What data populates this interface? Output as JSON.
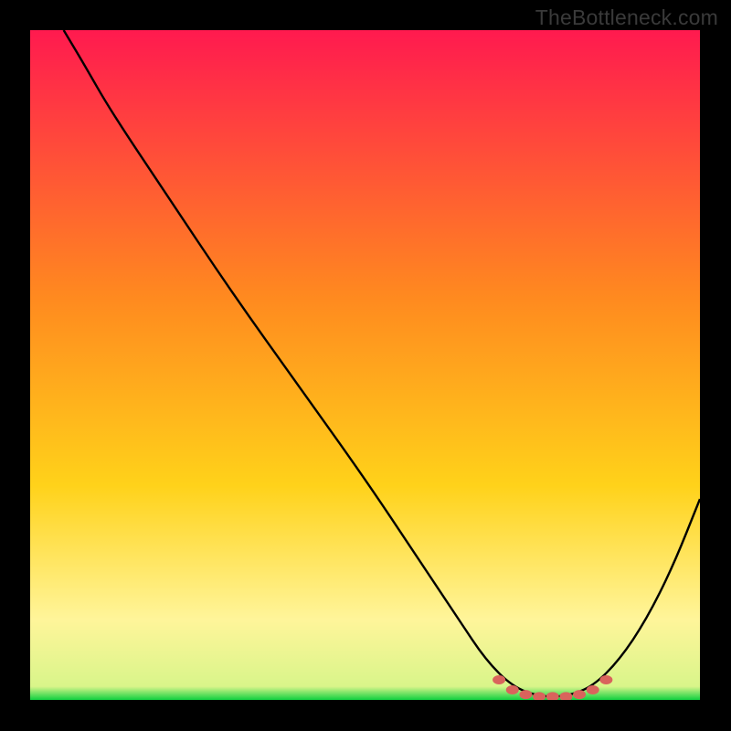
{
  "attribution": "TheBottleneck.com",
  "colors": {
    "bg": "#000000",
    "text": "#3a3a3a",
    "curve": "#000000",
    "markers": "#d9635c",
    "grad_top": "#ff1a4f",
    "grad_mid1": "#ff6a33",
    "grad_mid2": "#ffd21a",
    "grad_mid3": "#fff59a",
    "grad_bottom": "#10d040"
  },
  "chart_data": {
    "type": "line",
    "title": "",
    "xlabel": "",
    "ylabel": "",
    "xlim": [
      0,
      100
    ],
    "ylim": [
      0,
      100
    ],
    "curve": [
      {
        "x": 5,
        "y": 100
      },
      {
        "x": 8,
        "y": 95
      },
      {
        "x": 12,
        "y": 88
      },
      {
        "x": 20,
        "y": 76
      },
      {
        "x": 30,
        "y": 61
      },
      {
        "x": 40,
        "y": 47
      },
      {
        "x": 50,
        "y": 33
      },
      {
        "x": 58,
        "y": 21
      },
      {
        "x": 64,
        "y": 12
      },
      {
        "x": 68,
        "y": 6
      },
      {
        "x": 72,
        "y": 2
      },
      {
        "x": 76,
        "y": 0.5
      },
      {
        "x": 80,
        "y": 0.5
      },
      {
        "x": 84,
        "y": 2
      },
      {
        "x": 88,
        "y": 6
      },
      {
        "x": 92,
        "y": 12
      },
      {
        "x": 96,
        "y": 20
      },
      {
        "x": 100,
        "y": 30
      }
    ],
    "markers": [
      {
        "x": 70,
        "y": 3
      },
      {
        "x": 72,
        "y": 1.5
      },
      {
        "x": 74,
        "y": 0.8
      },
      {
        "x": 76,
        "y": 0.5
      },
      {
        "x": 78,
        "y": 0.5
      },
      {
        "x": 80,
        "y": 0.5
      },
      {
        "x": 82,
        "y": 0.8
      },
      {
        "x": 84,
        "y": 1.5
      },
      {
        "x": 86,
        "y": 3
      }
    ]
  }
}
